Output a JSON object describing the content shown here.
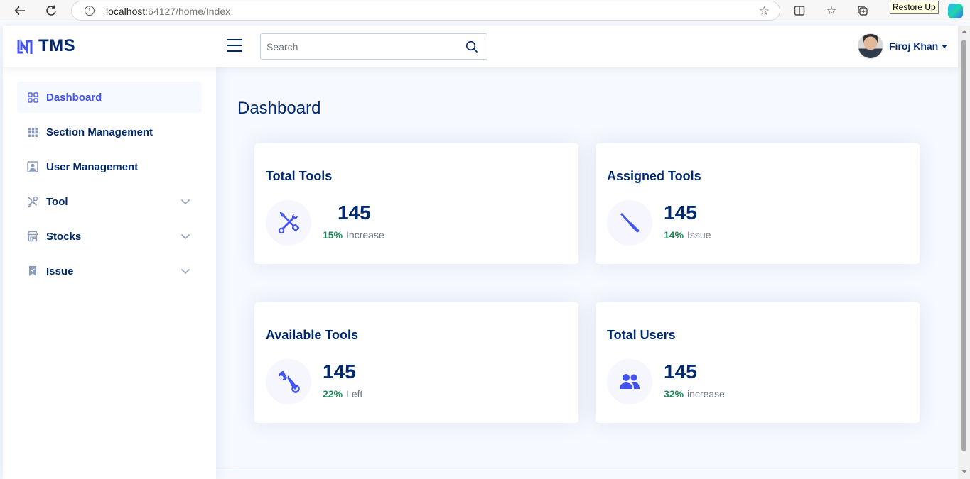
{
  "browser": {
    "url_host": "localhost",
    "url_rest": ":64127/home/Index",
    "tooltip": "Restore Up"
  },
  "header": {
    "logo_text": "TMS",
    "search_placeholder": "Search",
    "user_name": "Firoj Khan"
  },
  "sidebar": {
    "items": [
      {
        "label": "Dashboard",
        "icon": "grid-icon",
        "active": true
      },
      {
        "label": "Section Management",
        "icon": "menu-button-icon"
      },
      {
        "label": "User Management",
        "icon": "person-square-icon"
      },
      {
        "label": "Tool",
        "icon": "tools-icon",
        "expandable": true
      },
      {
        "label": "Stocks",
        "icon": "shop-icon",
        "expandable": true
      },
      {
        "label": "Issue",
        "icon": "bookmark-icon",
        "expandable": true
      }
    ]
  },
  "main": {
    "title": "Dashboard",
    "cards": [
      {
        "title": "Total Tools",
        "value": "145",
        "pct": "15%",
        "desc": "Increase",
        "icon": "tools-icon"
      },
      {
        "title": "Assigned Tools",
        "value": "145",
        "pct": "14%",
        "desc": "Issue",
        "icon": "screwdriver-icon"
      },
      {
        "title": "Available Tools",
        "value": "145",
        "pct": "22%",
        "desc": "Left",
        "icon": "wrench-icon"
      },
      {
        "title": "Total Users",
        "value": "145",
        "pct": "32%",
        "desc": "increase",
        "icon": "people-icon"
      }
    ]
  },
  "colors": {
    "primary": "#4154f1",
    "navy": "#012970",
    "success": "#198754",
    "background": "#f6f9ff"
  }
}
